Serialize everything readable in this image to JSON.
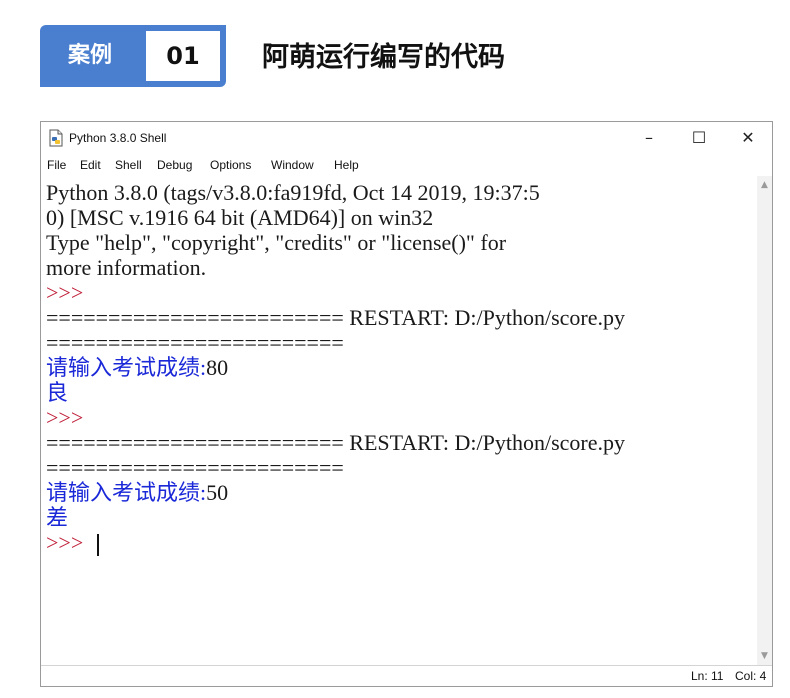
{
  "case_header": {
    "label": "案例",
    "number": "01",
    "title": "阿萌运行编写的代码",
    "accent_color": "#4a7fd0"
  },
  "window": {
    "title": "Python 3.8.0 Shell",
    "icon": "python-idle-icon",
    "controls": {
      "minimize": "–",
      "maximize": "☐",
      "close": "✕"
    }
  },
  "menubar": {
    "items": [
      "File",
      "Edit",
      "Shell",
      "Debug",
      "Options",
      "Window",
      "Help"
    ]
  },
  "shell": {
    "lines": [
      "Python 3.8.0 (tags/v3.8.0:fa919fd, Oct 14 2019, 19:37:5",
      "0) [MSC v.1916 64 bit (AMD64)] on win32",
      "Type \"help\", \"copyright\", \"credits\" or \"license()\" for",
      "more information.",
      ">>>",
      "======================== RESTART: D:/Python/score.py",
      "========================",
      "请输入考试成绩:",
      "80",
      "良",
      ">>>",
      "======================== RESTART: D:/Python/score.py",
      "========================",
      "请输入考试成绩:",
      "50",
      "差",
      ">>> "
    ],
    "colors": {
      "prompt": "#c0203a",
      "output": "#1a28d8",
      "text": "#1a1a1a"
    }
  },
  "statusbar": {
    "ln": "Ln: 11",
    "col": "Col: 4"
  }
}
